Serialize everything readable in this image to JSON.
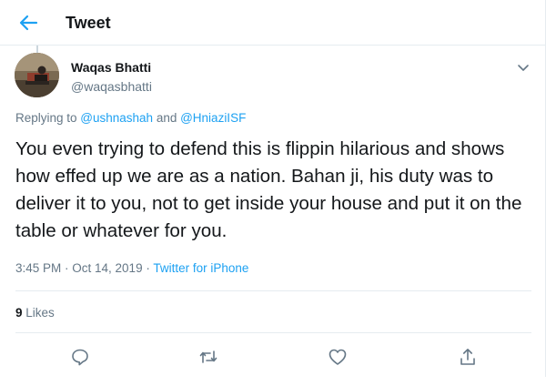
{
  "header": {
    "title": "Tweet"
  },
  "tweet": {
    "author_name": "Waqas Bhatti",
    "author_handle": "@waqasbhatti",
    "replying_prefix": "Replying to ",
    "reply_user_1": "@ushnashah",
    "reply_and": " and ",
    "reply_user_2": "@HniaziISF",
    "text": "You even trying to defend this is flippin hilarious and shows how effed up we are as a nation. Bahan ji, his duty was to deliver it to you, not to get inside your house and put it on the table or whatever for you.",
    "timestamp": "3:45 PM · Oct 14, 2019 · ",
    "source": "Twitter for iPhone",
    "likes_count": "9",
    "likes_label": " Likes"
  },
  "actions": [
    "reply-icon",
    "retweet-icon",
    "like-icon",
    "share-icon"
  ],
  "colors": {
    "accent": "#1da1f2",
    "muted": "#657786",
    "text": "#14171a",
    "divider": "#e6ecf0"
  }
}
